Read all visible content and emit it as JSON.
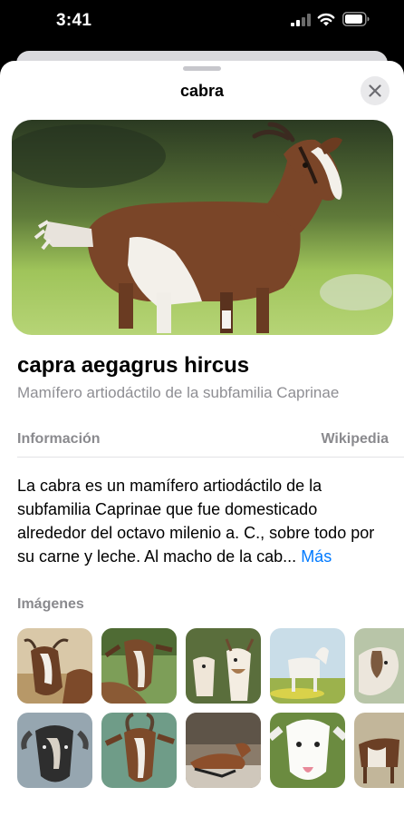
{
  "status_bar": {
    "time": "3:41"
  },
  "sheet": {
    "title": "cabra"
  },
  "subject": {
    "name": "capra aegagrus hircus",
    "description": "Mamífero artiodáctilo de la subfamilia Caprinae"
  },
  "info": {
    "label": "Información",
    "source": "Wikipedia",
    "summary": "La cabra es un mamífero artiodáctilo de la subfamilia Caprinae que fue domesticado alrededor del octavo milenio a. C., sobre todo por su carne y leche.  Al macho de la cab...",
    "more_label": "Más"
  },
  "images": {
    "label": "Imágenes"
  }
}
